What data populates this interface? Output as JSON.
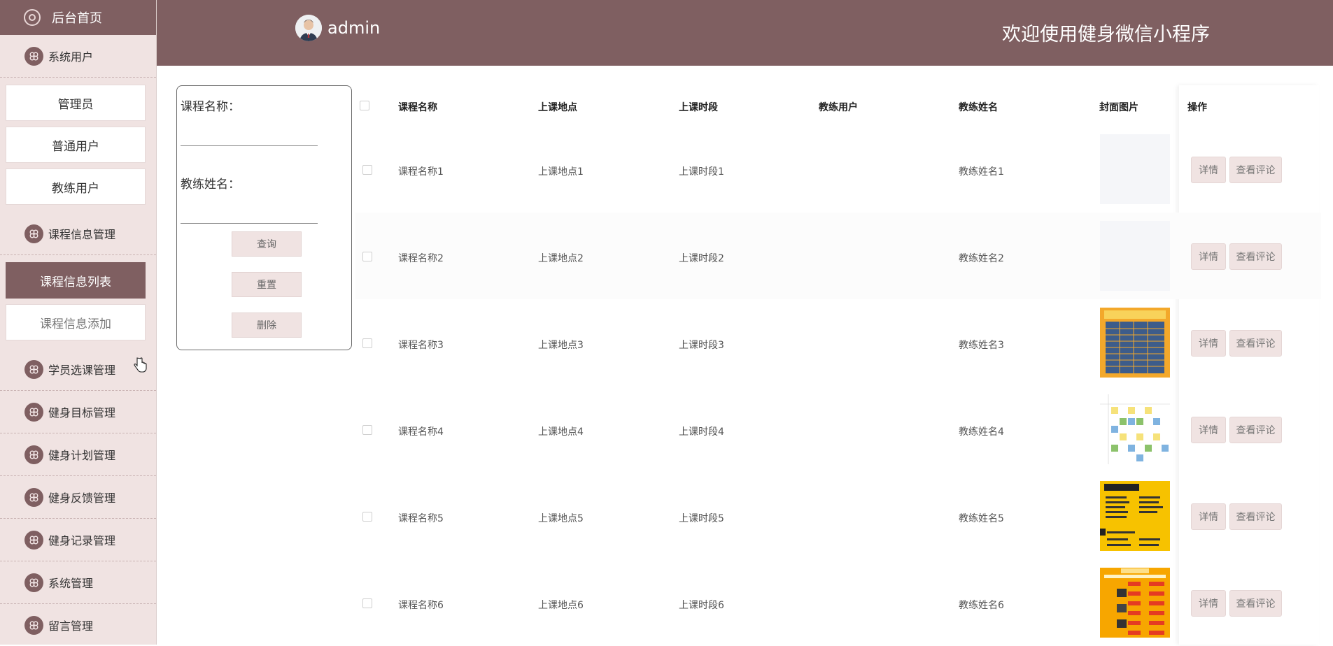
{
  "sidebar": {
    "home_label": "后台首页",
    "groups": [
      {
        "label": "系统用户"
      },
      {
        "label": "课程信息管理"
      },
      {
        "label": "学员选课管理"
      },
      {
        "label": "健身目标管理"
      },
      {
        "label": "健身计划管理"
      },
      {
        "label": "健身反馈管理"
      },
      {
        "label": "健身记录管理"
      },
      {
        "label": "系统管理"
      },
      {
        "label": "留言管理"
      }
    ],
    "user_sub": [
      {
        "label": "管理员"
      },
      {
        "label": "普通用户"
      },
      {
        "label": "教练用户"
      }
    ],
    "course_sub": [
      {
        "label": "课程信息列表",
        "active": true
      },
      {
        "label": "课程信息添加",
        "active": false
      }
    ]
  },
  "header": {
    "username": "admin",
    "welcome": "欢迎使用健身微信小程序",
    "color": "#7f5f61"
  },
  "search": {
    "course_name_label": "课程名称：",
    "course_name_value": "",
    "coach_name_label": "教练姓名：",
    "coach_name_value": "",
    "query_label": "查询",
    "reset_label": "重置",
    "delete_label": "删除"
  },
  "table": {
    "columns": [
      "课程名称",
      "上课地点",
      "上课时段",
      "教练用户",
      "教练姓名",
      "封面图片",
      "操作"
    ],
    "rows": [
      {
        "course_name": "课程名称1",
        "location": "上课地点1",
        "period": "上课时段1",
        "coach_user": "",
        "coach_name": "教练姓名1",
        "cover": "blank"
      },
      {
        "course_name": "课程名称2",
        "location": "上课地点2",
        "period": "上课时段2",
        "coach_user": "",
        "coach_name": "教练姓名2",
        "cover": "blank"
      },
      {
        "course_name": "课程名称3",
        "location": "上课地点3",
        "period": "上课时段3",
        "coach_user": "",
        "coach_name": "教练姓名3",
        "cover": "schedule-orange-blue"
      },
      {
        "course_name": "课程名称4",
        "location": "上课地点4",
        "period": "上课时段4",
        "coach_user": "",
        "coach_name": "教练姓名4",
        "cover": "schedule-grid-colored"
      },
      {
        "course_name": "课程名称5",
        "location": "上课地点5",
        "period": "上课时段5",
        "coach_user": "",
        "coach_name": "教练姓名5",
        "cover": "schedule-yellow-list"
      },
      {
        "course_name": "课程名称6",
        "location": "上课地点6",
        "period": "上课时段6",
        "coach_user": "",
        "coach_name": "教练姓名6",
        "cover": "schedule-orange-red"
      }
    ],
    "detail_label": "详情",
    "comment_label": "查看评论"
  }
}
